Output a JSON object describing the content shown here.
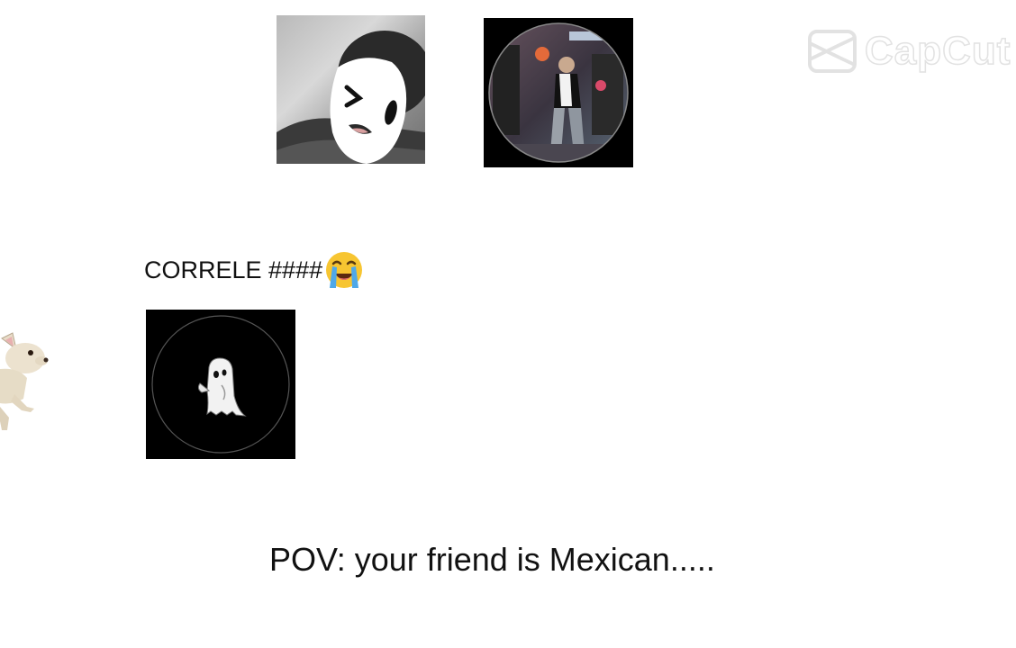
{
  "watermark": {
    "text": "CapCut",
    "icon": "capcut-logo-icon"
  },
  "avatars": [
    {
      "icon": "masked-person-avatar-icon"
    },
    {
      "icon": "dancing-person-avatar-icon"
    }
  ],
  "caption": {
    "text": "CORRELE ####",
    "emoji": "loudly-crying-face-icon"
  },
  "stickers": {
    "dog": "chihuahua-sticker-icon",
    "ghost": "ghost-icon"
  },
  "bottom_caption": {
    "text": "POV: your friend is Mexican....."
  },
  "colors": {
    "background": "#ffffff",
    "tile_background": "#000000",
    "watermark": "#e2e2e2",
    "text": "#111111"
  }
}
